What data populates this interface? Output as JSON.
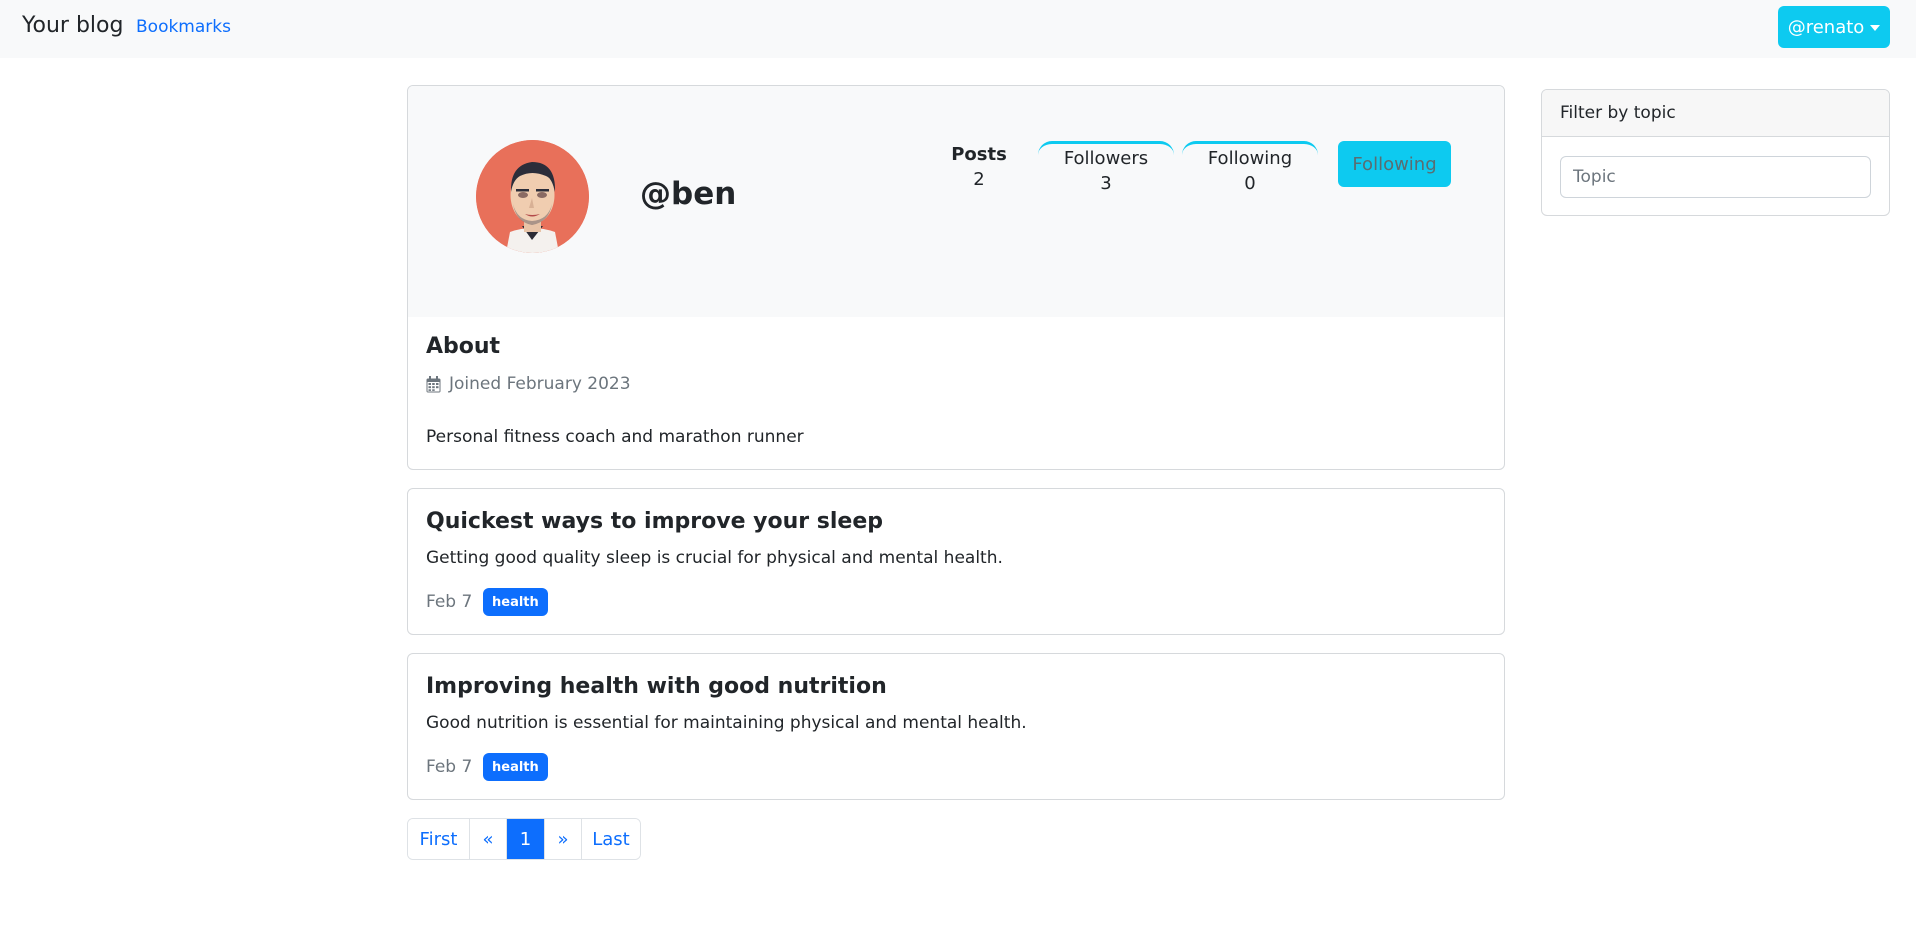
{
  "navbar": {
    "brand": "Your blog",
    "bookmarks": "Bookmarks",
    "user": "@renato"
  },
  "profile": {
    "username": "@ben",
    "stats": {
      "posts_label": "Posts",
      "posts_value": "2",
      "followers_label": "Followers",
      "followers_value": "3",
      "following_label": "Following",
      "following_value": "0"
    },
    "follow_button": "Following",
    "about_title": "About",
    "joined": "Joined February 2023",
    "bio": "Personal fitness coach and marathon runner"
  },
  "posts": [
    {
      "title": "Quickest ways to improve your sleep",
      "body": "Getting good quality sleep is crucial for physical and mental health.",
      "date": "Feb 7",
      "tag": "health"
    },
    {
      "title": "Improving health with good nutrition",
      "body": "Good nutrition is essential for maintaining physical and mental health.",
      "date": "Feb 7",
      "tag": "health"
    }
  ],
  "pagination": {
    "first": "First",
    "prev": "«",
    "current": "1",
    "next": "»",
    "last": "Last"
  },
  "sidebar": {
    "filter_title": "Filter by topic",
    "topic_placeholder": "Topic"
  },
  "colors": {
    "primary": "#0d6efd",
    "info": "#0dcaf0",
    "muted": "#6c757d"
  }
}
